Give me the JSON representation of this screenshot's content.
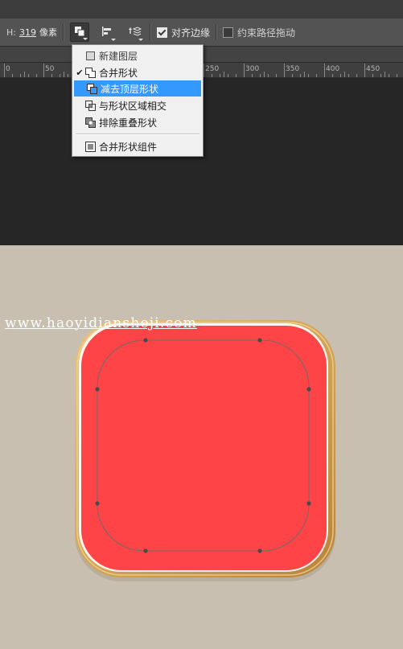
{
  "toolbar": {
    "height_label": "H:",
    "height_value": "319",
    "height_unit": "像素",
    "align_edges_label": "对齐边缘",
    "align_edges_checked": true,
    "constrain_path_label": "约束路径拖动",
    "constrain_path_checked": false,
    "icons": [
      "path-operations-icon",
      "path-alignment-icon",
      "path-arrangement-icon"
    ]
  },
  "ruler": {
    "labels": [
      "0",
      "50",
      "250",
      "300",
      "350",
      "400",
      "450"
    ]
  },
  "menu": {
    "items": [
      {
        "label": "新建图层",
        "icon": "new-layer-icon",
        "checked": false,
        "selected": false
      },
      {
        "label": "合并形状",
        "icon": "combine-shapes-icon",
        "checked": true,
        "selected": false
      },
      {
        "label": "减去顶层形状",
        "icon": "subtract-front-shape-icon",
        "checked": false,
        "selected": true
      },
      {
        "label": "与形状区域相交",
        "icon": "intersect-shape-areas-icon",
        "checked": false,
        "selected": false
      },
      {
        "label": "排除重叠形状",
        "icon": "exclude-overlapping-shapes-icon",
        "checked": false,
        "selected": false
      },
      {
        "label": "合并形状组件",
        "icon": "merge-shape-components-icon",
        "checked": false,
        "selected": false
      }
    ]
  },
  "canvas": {
    "watermark": "www.haoyidiansheji.com",
    "background_color": "#c8bfb0",
    "shape_fill_color": "#ff4447",
    "frame_color": "#d4a559"
  }
}
